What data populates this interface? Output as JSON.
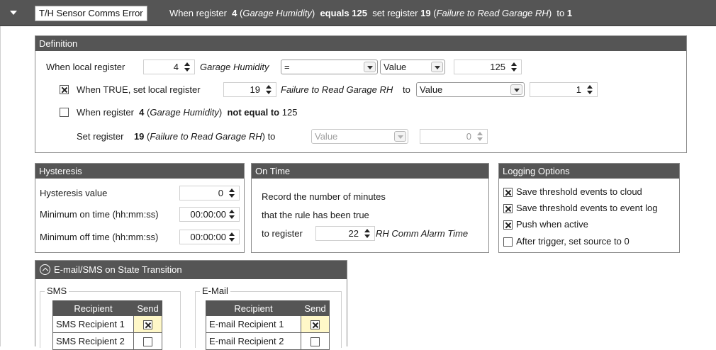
{
  "header": {
    "rule_name": "T/H Sensor Comms Error",
    "summary_prefix": "When register",
    "summary_src_reg": "4",
    "summary_src_name": "Garage Humidity",
    "summary_op": "equals",
    "summary_value": "125",
    "summary_mid": "set register",
    "summary_dst_reg": "19",
    "summary_dst_name": "Failure to Read Garage RH",
    "summary_to": "to",
    "summary_set_value": "1"
  },
  "definition": {
    "title": "Definition",
    "when_local_register_label": "When local register",
    "local_register": "4",
    "local_register_name": "Garage Humidity",
    "operator": "=",
    "compare_type": "Value",
    "compare_value": "125",
    "when_true_checked": true,
    "when_true_label": "When TRUE, set local register",
    "set_register": "19",
    "set_register_name": "Failure to Read Garage RH",
    "set_to_label": "to",
    "set_type": "Value",
    "set_value": "1",
    "not_equal_checked": false,
    "not_equal_prefix": "When register",
    "not_equal_reg": "4",
    "not_equal_name": "Garage Humidity",
    "not_equal_text": "not equal to",
    "not_equal_value": "125",
    "else_set_label": "Set register",
    "else_reg": "19",
    "else_name": "Failure to Read Garage RH",
    "else_to": "to",
    "else_type": "Value",
    "else_value": "0"
  },
  "hysteresis": {
    "title": "Hysteresis",
    "value_label": "Hysteresis value",
    "value": "0",
    "min_on_label": "Minimum on time (hh:mm:ss)",
    "min_on": "00:00:00",
    "min_off_label": "Minimum off time (hh:mm:ss)",
    "min_off": "00:00:00"
  },
  "on_time": {
    "title": "On Time",
    "line1": "Record the number of minutes",
    "line2": "that the rule has been true",
    "to_register_label": "to register",
    "register": "22",
    "register_name": "RH Comm Alarm Time"
  },
  "logging": {
    "title": "Logging Options",
    "options": [
      {
        "label": "Save threshold events to cloud",
        "checked": true
      },
      {
        "label": "Save threshold events to event log",
        "checked": true
      },
      {
        "label": "Push when active",
        "checked": true
      },
      {
        "label": "After trigger, set source to 0",
        "checked": false
      }
    ]
  },
  "notify": {
    "title": "E-mail/SMS on State Transition",
    "sms": {
      "label": "SMS",
      "col_recipient": "Recipient",
      "col_send": "Send",
      "rows": [
        {
          "name": "SMS Recipient 1",
          "send": true
        },
        {
          "name": "SMS Recipient 2",
          "send": false
        }
      ]
    },
    "email": {
      "label": "E-Mail",
      "col_recipient": "Recipient",
      "col_send": "Send",
      "rows": [
        {
          "name": "E-mail Recipient 1",
          "send": true
        },
        {
          "name": "E-mail Recipient 2",
          "send": false
        }
      ]
    }
  }
}
